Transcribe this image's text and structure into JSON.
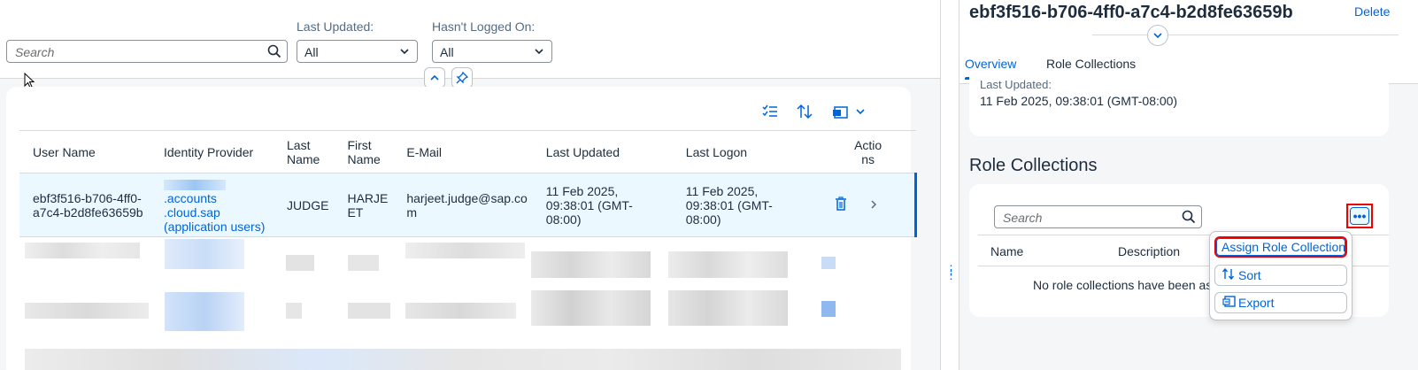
{
  "filter_bar": {
    "search_placeholder": "Search",
    "last_updated_label": "Last Updated:",
    "last_updated_value": "All",
    "not_logged_label": "Hasn't Logged On:",
    "not_logged_value": "All"
  },
  "table": {
    "headers": [
      "User Name",
      "Identity Provider",
      "Last\nName",
      "First\nName",
      "E-Mail",
      "Last Updated",
      "Last Logon",
      "Actio\nns"
    ],
    "selected_row": {
      "user_name": "ebf3f516-b706-4ff0-a7c4-b2d8fe63659b",
      "identity_provider": ".accounts .cloud.sap (application users)",
      "last_name": "JUDGE",
      "first_name": "HARJE ET",
      "email": "harjeet.judge@sap.co m",
      "last_updated": "11 Feb 2025, 09:38:01 (GMT-08:00)",
      "last_logon": "11 Feb 2025, 09:38:01 (GMT-08:00)"
    }
  },
  "detail": {
    "title": "ebf3f516-b706-4ff0-a7c4-b2d8fe63659b",
    "delete_label": "Delete",
    "tabs": [
      {
        "label": "Overview",
        "active": true
      },
      {
        "label": "Role Collections",
        "active": false
      }
    ],
    "overview": {
      "last_updated_label": "Last Updated:",
      "last_updated_value": "11 Feb 2025, 09:38:01 (GMT-08:00)"
    },
    "role_collections": {
      "heading": "Role Collections",
      "search_placeholder": "Search",
      "more_label": "•••",
      "col_name": "Name",
      "col_description": "Description",
      "empty_text": "No role collections have been assign"
    }
  },
  "menu": {
    "items": [
      {
        "label": "Assign Role Collection",
        "icon": ""
      },
      {
        "label": "Sort",
        "icon": "sort-icon"
      },
      {
        "label": "Export",
        "icon": "export-icon"
      }
    ]
  },
  "colors": {
    "accent": "#0064d9",
    "highlight": "#ee0000",
    "selected_row": "#ebf8ff"
  }
}
